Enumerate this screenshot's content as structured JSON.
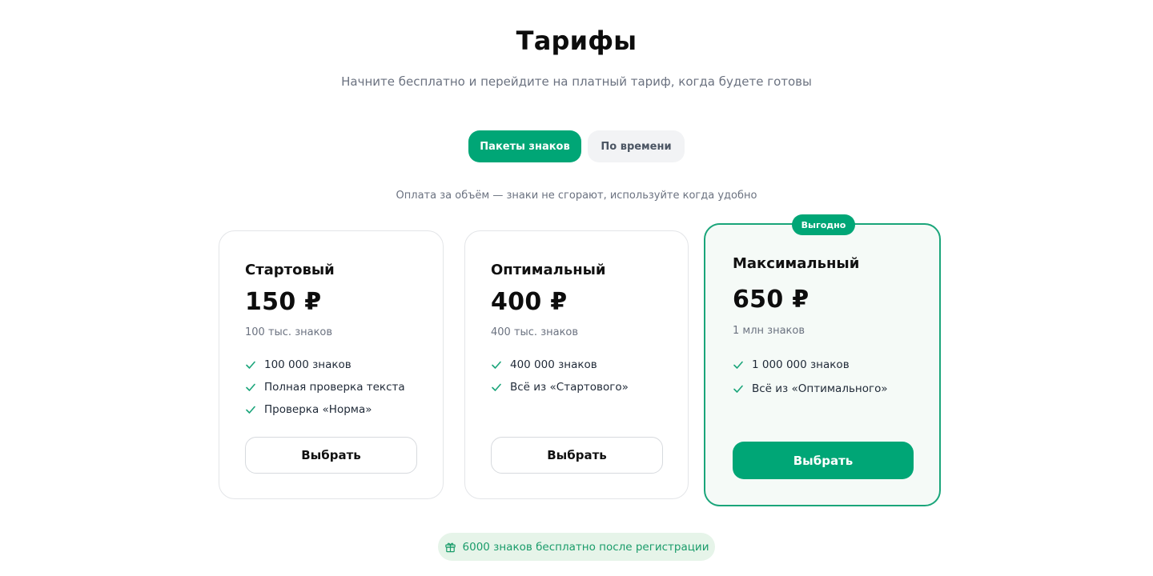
{
  "header": {
    "title": "Тарифы",
    "subtitle": "Начните бесплатно и перейдите на платный тариф, когда будете готовы"
  },
  "tabs": [
    {
      "label": "Пакеты знаков",
      "active": true
    },
    {
      "label": "По времени",
      "active": false
    }
  ],
  "note": "Оплата за объём — знаки не сгорают, используйте когда удобно",
  "plans": [
    {
      "name": "Стартовый",
      "price": "150 ₽",
      "volume": "100 тыс. знаков",
      "features": [
        "100 000 знаков",
        "Полная проверка текста",
        "Проверка «Норма»"
      ],
      "button": "Выбрать"
    },
    {
      "name": "Оптимальный",
      "price": "400 ₽",
      "volume": "400 тыс. знаков",
      "features": [
        "400 000 знаков",
        "Всё из «Стартового»"
      ],
      "button": "Выбрать"
    },
    {
      "name": "Максимальный",
      "badge": "Выгодно",
      "price": "650 ₽",
      "volume": "1 млн знаков",
      "features": [
        "1 000 000 знаков",
        "Всё из «Оптимального»"
      ],
      "button": "Выбрать",
      "highlighted": true
    }
  ],
  "gift": {
    "icon": "gift-icon",
    "text": "6000 знаков бесплатно после регистрации"
  },
  "colors": {
    "accent": "#00a676",
    "highlight_border": "#1aa57a",
    "highlight_bg": "#f5faf7",
    "gift_bg": "#e6f4e9"
  }
}
